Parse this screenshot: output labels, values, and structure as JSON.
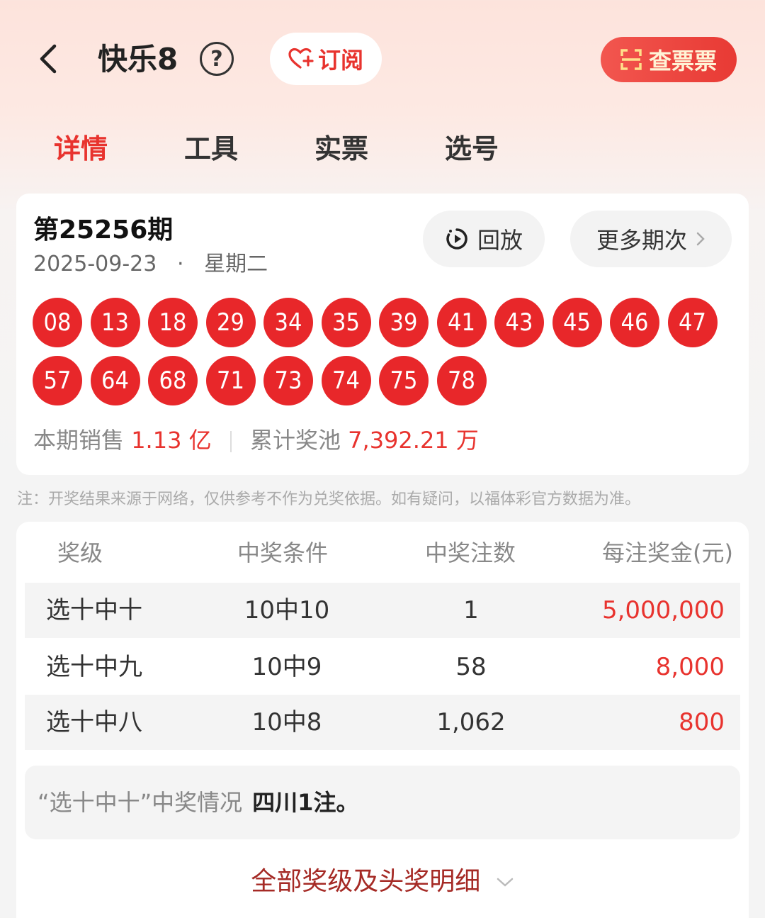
{
  "header": {
    "title": "快乐8",
    "help_icon": "question-circle-icon",
    "subscribe_label": "订阅",
    "check_ticket_label": "查票票"
  },
  "tabs": [
    {
      "label": "详情",
      "active": true
    },
    {
      "label": "工具",
      "active": false
    },
    {
      "label": "实票",
      "active": false
    },
    {
      "label": "选号",
      "active": false
    }
  ],
  "draw": {
    "issue": "第25256期",
    "date": "2025-09-23",
    "separator": "·",
    "weekday": "星期二",
    "replay_label": "回放",
    "more_label": "更多期次",
    "numbers": [
      "08",
      "13",
      "18",
      "29",
      "34",
      "35",
      "39",
      "41",
      "43",
      "45",
      "46",
      "47",
      "57",
      "64",
      "68",
      "71",
      "73",
      "74",
      "75",
      "78"
    ],
    "sales_label": "本期销售",
    "sales_value": "1.13 亿",
    "pool_label": "累计奖池",
    "pool_value": "7,392.21 万",
    "ball_color": "#e8272a"
  },
  "note": "注：开奖结果来源于网络，仅供参考不作为兑奖依据。如有疑问，以福体彩官方数据为准。",
  "prize_table": {
    "headers": [
      "奖级",
      "中奖条件",
      "中奖注数",
      "每注奖金(元)"
    ],
    "rows": [
      {
        "level": "选十中十",
        "condition": "10中10",
        "count": "1",
        "prize": "5,000,000"
      },
      {
        "level": "选十中九",
        "condition": "10中9",
        "count": "58",
        "prize": "8,000"
      },
      {
        "level": "选十中八",
        "condition": "10中8",
        "count": "1,062",
        "prize": "800"
      }
    ]
  },
  "winners": {
    "label": "“选十中十”中奖情况",
    "value": "四川1注。"
  },
  "all_prizes_label": "全部奖级及头奖明细",
  "colors": {
    "accent": "#e8332e",
    "link": "#a52a25"
  }
}
